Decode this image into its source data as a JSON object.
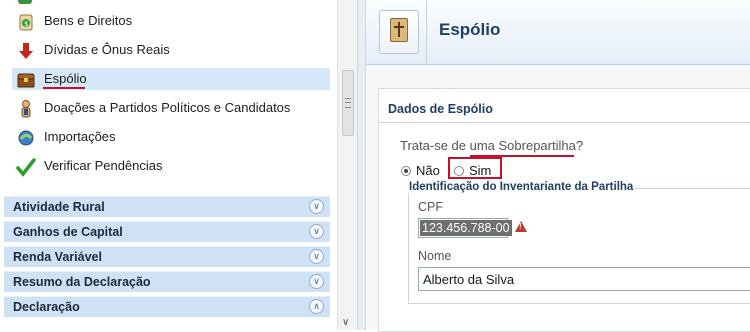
{
  "sidebar": {
    "items": [
      {
        "label": "Bens e Direitos",
        "icon": "money-bag-icon"
      },
      {
        "label": "Dívidas e Ônus Reais",
        "icon": "red-down-arrow-icon"
      },
      {
        "label": "Espólio",
        "icon": "treasure-chest-icon",
        "selected": true
      },
      {
        "label": "Doações a Partidos Políticos e Candidatos",
        "icon": "donation-icon"
      },
      {
        "label": "Importações",
        "icon": "import-icon"
      },
      {
        "label": "Verificar Pendências",
        "icon": "check-icon"
      }
    ],
    "sections": [
      {
        "label": "Atividade Rural",
        "state": "collapsed"
      },
      {
        "label": "Ganhos de Capital",
        "state": "collapsed"
      },
      {
        "label": "Renda Variável",
        "state": "collapsed"
      },
      {
        "label": "Resumo da Declaração",
        "state": "collapsed"
      },
      {
        "label": "Declaração",
        "state": "expanded"
      }
    ]
  },
  "header": {
    "title": "Espólio",
    "icon": "bible-icon"
  },
  "form": {
    "section_title": "Dados de Espólio",
    "question": "Trata-se de uma Sobrepartilha?",
    "options": [
      {
        "label": "Não",
        "selected": true
      },
      {
        "label": "Sim",
        "selected": false
      }
    ],
    "group_title": "Identificação do Inventariante da Partilha",
    "cpf_label": "CPF",
    "cpf_value": "123.456.788-00",
    "nome_label": "Nome",
    "nome_value": "Alberto da Silva"
  },
  "colors": {
    "highlight": "#c8102e",
    "accent": "#1f3f66",
    "section_bar": "#cfe1f4"
  }
}
